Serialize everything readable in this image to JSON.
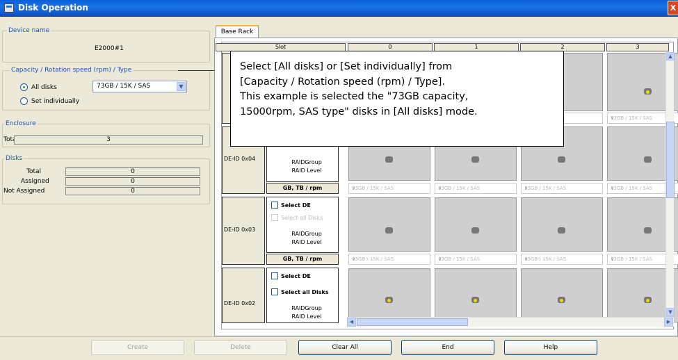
{
  "window": {
    "title": "Disk Operation",
    "close_label": "X"
  },
  "left": {
    "device_group": "Device name",
    "device_name": "E2000#1",
    "capacity_group": "Capacity / Rotation speed (rpm) / Type",
    "all_disks_label": "All disks",
    "combo_value": "73GB / 15K / SAS",
    "set_individually_label": "Set individually",
    "enclosure_group": "Enclosure",
    "enclosure_total_label": "Total",
    "enclosure_total_value": "3",
    "disks_group": "Disks",
    "disks_total_label": "Total",
    "disks_total_value": "0",
    "assigned_label": "Assigned",
    "assigned_value": "0",
    "not_assigned_label": "Not Assigned",
    "not_assigned_value": "0"
  },
  "tabs": {
    "base_rack": "Base Rack"
  },
  "grid": {
    "slot_header": "Slot",
    "columns": [
      "0",
      "1",
      "2",
      "3"
    ],
    "rows": [
      {
        "de_id": "DE-ID 0x04"
      },
      {
        "de_id": "DE-ID 0x03"
      },
      {
        "de_id": "DE-ID 0x02"
      }
    ],
    "select_de": "Select DE",
    "select_all_disks": "Select all Disks",
    "raid_group": "RAIDGroup",
    "raid_level": "RAID Level",
    "gb_tb_rpm": "GB, TB / rpm",
    "disk_type": "73GB / 15K / SAS",
    "disk_type_short_1": "AS",
    "disk_type_short_3": "73GB / 15K / SAS"
  },
  "callout": {
    "line1": "Select  [All disks]  or  [Set individually]  from",
    "line2": "[Capacity / Rotation speed (rpm) / Type].",
    "line3": "This example is selected the \"73GB capacity,",
    "line4": "15000rpm, SAS type\" disks in [All disks] mode."
  },
  "buttons": {
    "create": "Create",
    "delete": "Delete",
    "clear_all": "Clear All",
    "end": "End",
    "help": "Help"
  },
  "colors": {
    "group_label": "#1c4fc0",
    "title_bar": "#0a5fd8",
    "selected_disk": "#f2d900"
  }
}
